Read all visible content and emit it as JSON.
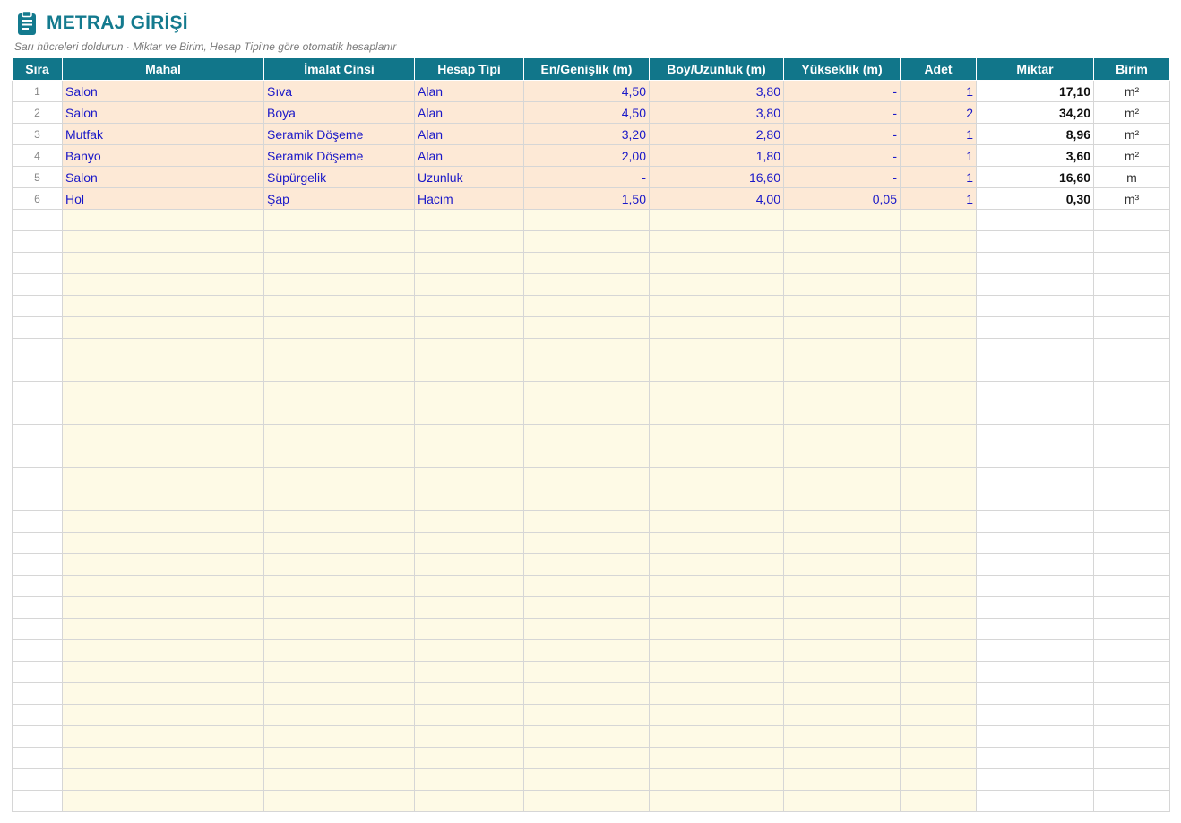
{
  "header": {
    "title": "METRAJ GİRİŞİ",
    "subtitle": "Sarı hücreleri doldurun · Miktar ve Birim, Hesap Tipi'ne göre otomatik hesaplanır",
    "icon": "clipboard-icon"
  },
  "colors": {
    "accent": "#137a8e",
    "header_bg": "#11768a",
    "input_filled_bg": "#fde9d6",
    "input_empty_bg": "#fefae6",
    "input_text": "#1a18c8"
  },
  "table": {
    "columns": [
      "Sıra",
      "Mahal",
      "İmalat Cinsi",
      "Hesap Tipi",
      "En/Genişlik (m)",
      "Boy/Uzunluk (m)",
      "Yükseklik (m)",
      "Adet",
      "Miktar",
      "Birim"
    ],
    "rows": [
      {
        "sira": "1",
        "mahal": "Salon",
        "imalat": "Sıva",
        "tip": "Alan",
        "en": "4,50",
        "boy": "3,80",
        "yukseklik": "-",
        "adet": "1",
        "miktar": "17,10",
        "birim": "m²"
      },
      {
        "sira": "2",
        "mahal": "Salon",
        "imalat": "Boya",
        "tip": "Alan",
        "en": "4,50",
        "boy": "3,80",
        "yukseklik": "-",
        "adet": "2",
        "miktar": "34,20",
        "birim": "m²"
      },
      {
        "sira": "3",
        "mahal": "Mutfak",
        "imalat": "Seramik Döşeme",
        "tip": "Alan",
        "en": "3,20",
        "boy": "2,80",
        "yukseklik": "-",
        "adet": "1",
        "miktar": "8,96",
        "birim": "m²"
      },
      {
        "sira": "4",
        "mahal": "Banyo",
        "imalat": "Seramik Döşeme",
        "tip": "Alan",
        "en": "2,00",
        "boy": "1,80",
        "yukseklik": "-",
        "adet": "1",
        "miktar": "3,60",
        "birim": "m²"
      },
      {
        "sira": "5",
        "mahal": "Salon",
        "imalat": "Süpürgelik",
        "tip": "Uzunluk",
        "en": "-",
        "boy": "16,60",
        "yukseklik": "-",
        "adet": "1",
        "miktar": "16,60",
        "birim": "m"
      },
      {
        "sira": "6",
        "mahal": "Hol",
        "imalat": "Şap",
        "tip": "Hacim",
        "en": "1,50",
        "boy": "4,00",
        "yukseklik": "0,05",
        "adet": "1",
        "miktar": "0,30",
        "birim": "m³"
      }
    ]
  }
}
